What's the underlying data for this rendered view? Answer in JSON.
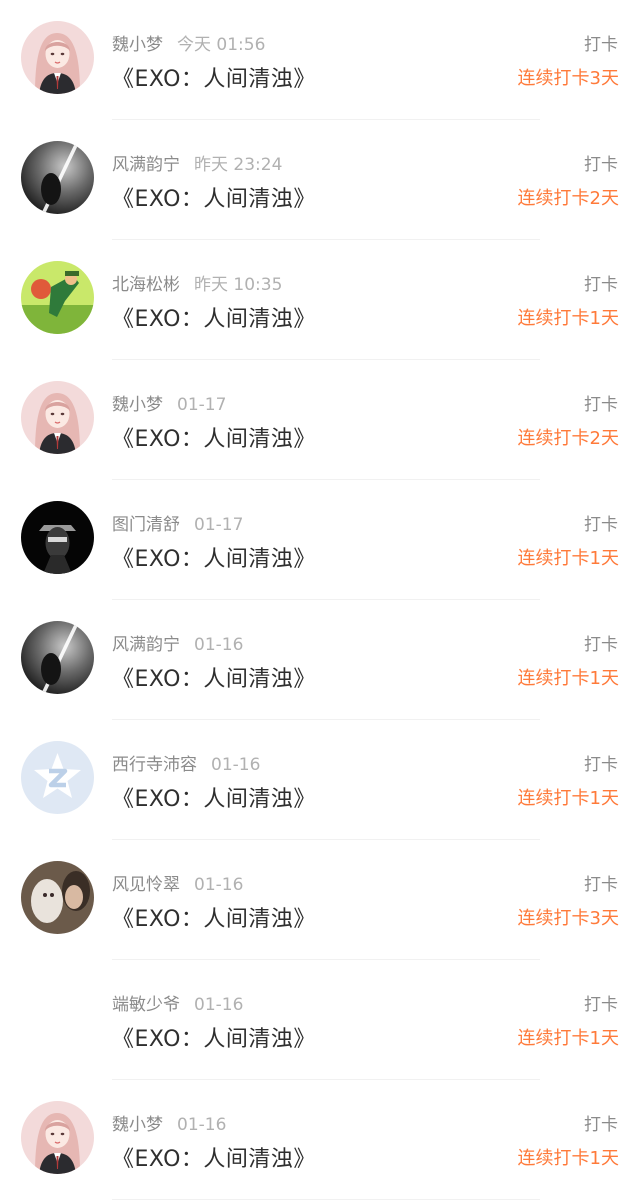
{
  "colors": {
    "streak": "#ff7a3a",
    "name": "#8b8b8b",
    "time": "#b1b1b1",
    "title": "#2f2f2f"
  },
  "checkins": [
    {
      "name": "魏小梦",
      "time": "今天 01:56",
      "title": "《EXO：人间清浊》",
      "tag": "打卡",
      "streak": "连续打卡3天",
      "avatar": "girl-avatar"
    },
    {
      "name": "风满韵宁",
      "time": "昨天 23:24",
      "title": "《EXO：人间清浊》",
      "tag": "打卡",
      "streak": "连续打卡2天",
      "avatar": "dark-light-avatar"
    },
    {
      "name": "北海松彬",
      "time": "昨天 10:35",
      "title": "《EXO：人间清浊》",
      "tag": "打卡",
      "streak": "连续打卡1天",
      "avatar": "cartoon-avatar"
    },
    {
      "name": "魏小梦",
      "time": "01-17",
      "title": "《EXO：人间清浊》",
      "tag": "打卡",
      "streak": "连续打卡2天",
      "avatar": "girl-avatar"
    },
    {
      "name": "图门清舒",
      "time": "01-17",
      "title": "《EXO：人间清浊》",
      "tag": "打卡",
      "streak": "连续打卡1天",
      "avatar": "dark-figure-avatar"
    },
    {
      "name": "风满韵宁",
      "time": "01-16",
      "title": "《EXO：人间清浊》",
      "tag": "打卡",
      "streak": "连续打卡1天",
      "avatar": "dark-light-avatar"
    },
    {
      "name": "西行寺沛容",
      "time": "01-16",
      "title": "《EXO：人间清浊》",
      "tag": "打卡",
      "streak": "连续打卡1天",
      "avatar": "default-q-avatar"
    },
    {
      "name": "风见怜翠",
      "time": "01-16",
      "title": "《EXO：人间清浊》",
      "tag": "打卡",
      "streak": "连续打卡3天",
      "avatar": "photo-avatar"
    },
    {
      "name": "端敏少爷",
      "time": "01-16",
      "title": "《EXO：人间清浊》",
      "tag": "打卡",
      "streak": "连续打卡1天",
      "avatar": "empty-avatar"
    },
    {
      "name": "魏小梦",
      "time": "01-16",
      "title": "《EXO：人间清浊》",
      "tag": "打卡",
      "streak": "连续打卡1天",
      "avatar": "girl-avatar"
    }
  ]
}
